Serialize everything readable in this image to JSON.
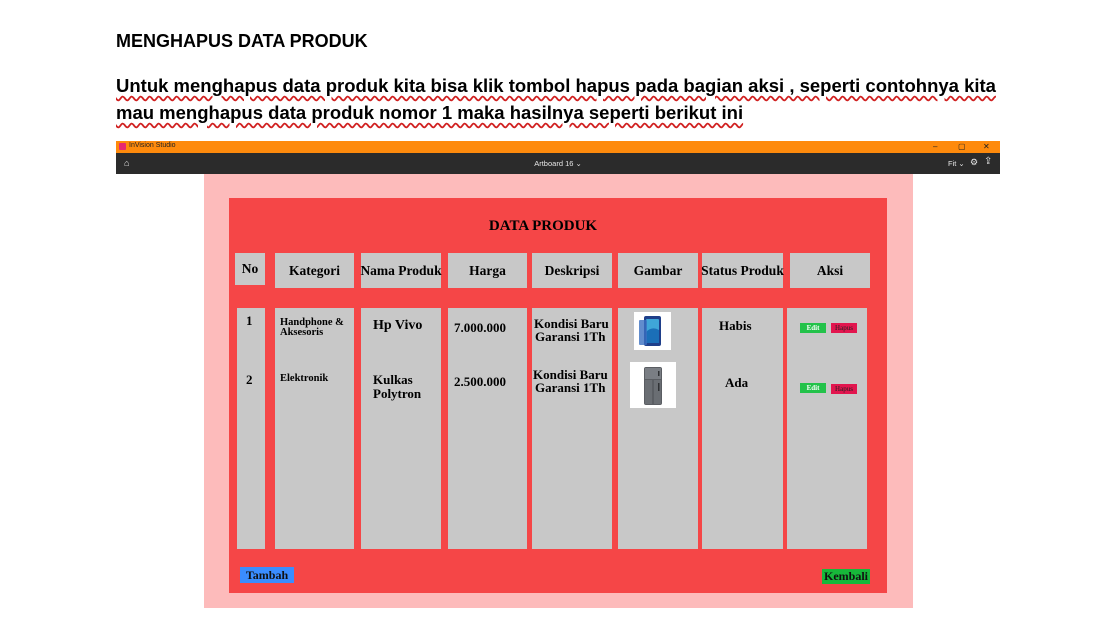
{
  "document": {
    "heading": "MENGHAPUS DATA PRODUK",
    "paragraph": "Untuk menghapus data produk kita bisa klik tombol hapus pada bagian aksi , seperti contohnya kita mau menghapus data produk nomor 1 maka hasilnya seperti berikut ini"
  },
  "window": {
    "app_name": "InVision Studio",
    "controls": [
      "–",
      "▢",
      "✕"
    ],
    "artboard_title": "Artboard 16 ⌄",
    "fit_label": "Fit ⌄",
    "icons": [
      "home-icon",
      "settings-icon",
      "share-icon"
    ],
    "accent_color": "#fe8a0c"
  },
  "artboard": {
    "title": "DATA PRODUK",
    "columns": [
      "No",
      "Kategori",
      "Nama Produk",
      "Harga",
      "Deskripsi",
      "Gambar",
      "Status Produk",
      "Aksi"
    ],
    "rows": [
      {
        "no": "1",
        "kategori_line1": "Handphone &",
        "kategori_line2": "Aksesoris",
        "nama": "Hp Vivo",
        "harga": "7.000.000",
        "deskripsi_line1": "Kondisi Baru",
        "deskripsi_line2": "Garansi 1Th",
        "gambar": "phone-image",
        "status": "Habis",
        "edit_label": "Edit",
        "hapus_label": "Hapus"
      },
      {
        "no": "2",
        "kategori_line1": "Elektronik",
        "kategori_line2": "",
        "nama_line1": "Kulkas",
        "nama_line2": "Polytron",
        "harga": "2.500.000",
        "deskripsi_line1": "Kondisi Baru",
        "deskripsi_line2": "Garansi 1Th",
        "gambar": "fridge-image",
        "status": "Ada",
        "edit_label": "Edit",
        "hapus_label": "Hapus"
      }
    ],
    "tambah_label": "Tambah",
    "kembali_label": "Kembali",
    "colors": {
      "artboard_bg": "#f54647",
      "canvas_bg": "#fdbbbb",
      "cell_bg": "#c8c8c8",
      "edit": "#23c24a",
      "hapus": "#e2154e",
      "tambah": "#3a8dff",
      "kembali": "#17b83a"
    }
  }
}
